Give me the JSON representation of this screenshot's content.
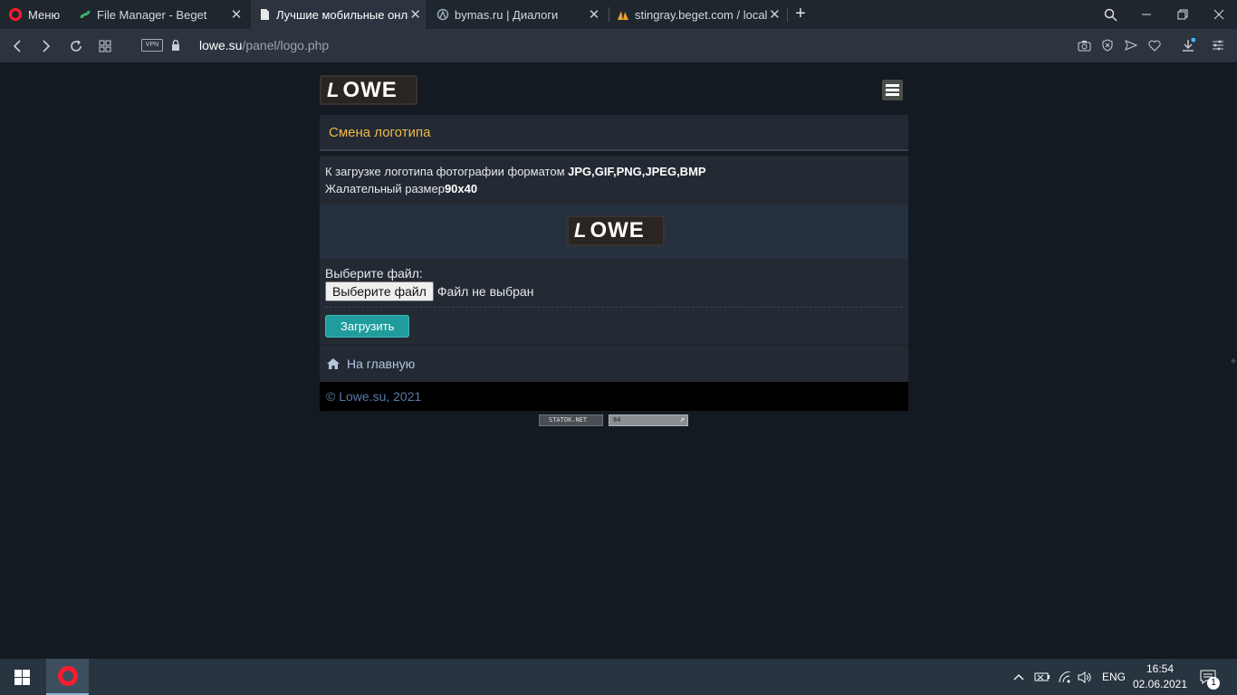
{
  "browser": {
    "menu_label": "Меню",
    "tabs": [
      {
        "label": "File Manager - Beget",
        "active": false
      },
      {
        "label": "Лучшие мобильные онлайн игры",
        "active": true
      },
      {
        "label": "bymas.ru | Диалоги",
        "active": false
      },
      {
        "label": "stingray.beget.com / localhost",
        "active": false
      }
    ],
    "address": {
      "vpn_label": "VPN",
      "url_host": "lowe.su",
      "url_path": "/panel/logo.php"
    }
  },
  "site": {
    "logo_mark": "L",
    "logo_text": "OWE"
  },
  "panel": {
    "title": "Смена логотипа",
    "info_line1_prefix": "К загрузке логотипа фотографии форматом ",
    "info_line1_formats": "JPG,GIF,PNG,JPEG,BMP",
    "info_line2_prefix": "Жалательный размер",
    "info_line2_size": "90x40",
    "file_label": "Выберите файл:",
    "file_button": "Выберите файл",
    "file_status": "Файл не выбран",
    "submit_label": "Загрузить",
    "home_link": "На главную",
    "footer": "© Lowe.su, 2021"
  },
  "counters": {
    "statok": "STATOK.NET",
    "hits": "84"
  },
  "taskbar": {
    "lang": "ENG",
    "time": "16:54",
    "date": "02.06.2021",
    "notification_count": "1"
  },
  "colors": {
    "accent_title": "#f1b949",
    "submit_bg": "#219c9c",
    "link": "#b6c5e0",
    "footer_text": "#5a7aa8",
    "page_bg": "#141a21"
  }
}
